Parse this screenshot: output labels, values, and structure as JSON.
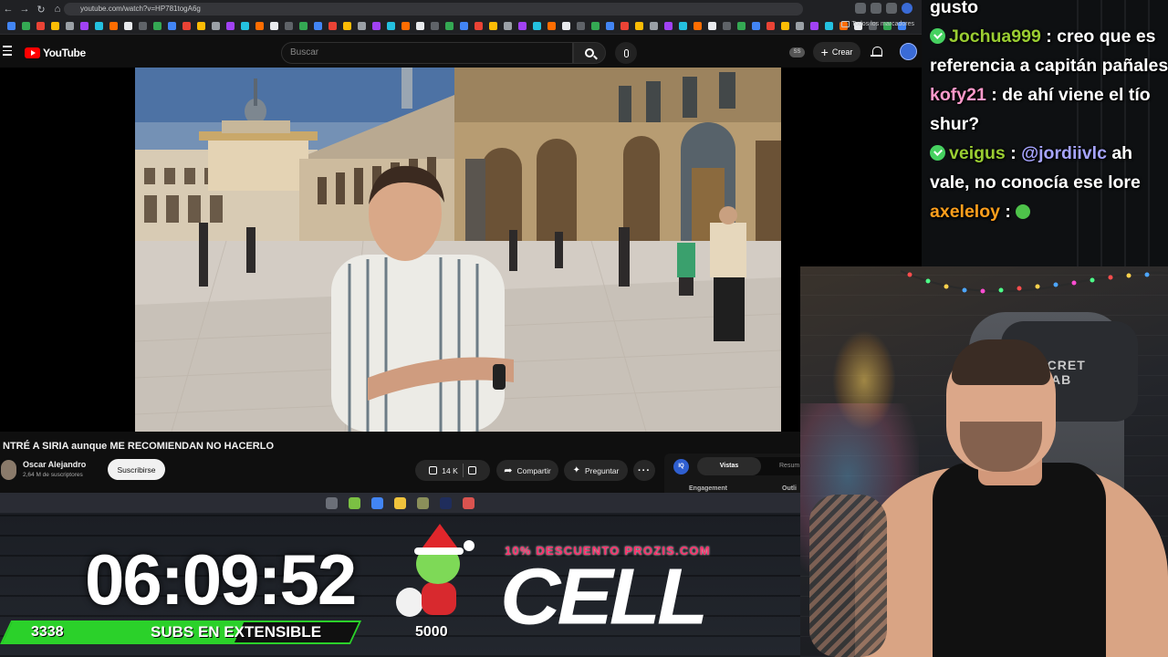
{
  "browser": {
    "url": "youtube.com/watch?v=HP781togA6g",
    "bookmarks_folder": "Todos los marcadores",
    "bookmark_icon_colors": [
      "#4285f4",
      "#34a853",
      "#ea4335",
      "#fbbc05",
      "#9aa0a6",
      "#a142f4",
      "#24c1e0",
      "#ff6d01",
      "#e8eaed",
      "#5f6368",
      "#34a853",
      "#4285f4",
      "#ea4335",
      "#fbbc05",
      "#9aa0a6",
      "#a142f4",
      "#24c1e0",
      "#ff6d01",
      "#e8eaed",
      "#5f6368",
      "#34a853",
      "#4285f4",
      "#ea4335",
      "#fbbc05",
      "#9aa0a6",
      "#a142f4",
      "#24c1e0",
      "#ff6d01",
      "#e8eaed",
      "#5f6368",
      "#34a853",
      "#4285f4",
      "#ea4335",
      "#fbbc05",
      "#9aa0a6",
      "#a142f4",
      "#24c1e0",
      "#ff6d01",
      "#e8eaed",
      "#5f6368",
      "#34a853",
      "#4285f4",
      "#ea4335",
      "#fbbc05",
      "#9aa0a6",
      "#a142f4",
      "#24c1e0",
      "#ff6d01",
      "#e8eaed",
      "#5f6368",
      "#34a853",
      "#4285f4",
      "#ea4335",
      "#fbbc05",
      "#9aa0a6",
      "#a142f4",
      "#24c1e0",
      "#ff6d01",
      "#e8eaed",
      "#5f6368",
      "#34a853",
      "#4285f4"
    ]
  },
  "youtube": {
    "logo_text": "YouTube",
    "search_placeholder": "Buscar",
    "ss_badge": "SS",
    "create_label": "Crear",
    "video_title": "NTRÉ A SIRIA aunque ME RECOMIENDAN NO HACERLO",
    "channel_name": "Oscar Alejandro",
    "channel_subs": "2,64 M de suscriptores",
    "subscribe_label": "Suscribirse",
    "likes": "14 K",
    "share_label": "Compartir",
    "ask_label": "Preguntar",
    "panel": {
      "logo": "IQ",
      "tab_active": "Vistas",
      "tab_other": "Resum",
      "label_engagement": "Engagement",
      "label_outlier": "Outli"
    }
  },
  "taskbar": {
    "icon_colors": [
      "#6b6f78",
      "#7bc043",
      "#4285f4",
      "#f0c33c",
      "#8a8f5a",
      "#1f2d5c",
      "#d9534f"
    ]
  },
  "chat": {
    "messages": [
      {
        "user": "",
        "text": "gusto",
        "badge": false,
        "color": "#ffffff"
      },
      {
        "user": "Jochua999",
        "text": " : creo que es referencia a capitán pañales",
        "badge": true,
        "color": "#9acd32"
      },
      {
        "user": "kofy21",
        "text": " : de ahí viene el tío shur?",
        "badge": false,
        "color": "#ff9acb"
      },
      {
        "user": "veigus",
        "text": " : ",
        "mention": "@jordiivlc",
        "after": " ah vale, no conocía ese lore",
        "badge": true,
        "color": "#9acd32"
      },
      {
        "user": "axeleloy",
        "text": " : ",
        "badge": false,
        "color": "#ff9f1c",
        "emote": true
      }
    ]
  },
  "cam": {
    "chair_logo": "SECRET LAB"
  },
  "overlay": {
    "timer": "06:09:52",
    "subs_count": "3338",
    "subs_goal": "5000",
    "subs_progress": 0.6676,
    "subs_label": "SUBS EN EXTENSIBLE",
    "promo_text": "10% DESCUENTO PROZIS.COM",
    "brand_text": "CELL",
    "accent_green": "#2bd12a",
    "promo_pink": "#ff2f6b"
  }
}
